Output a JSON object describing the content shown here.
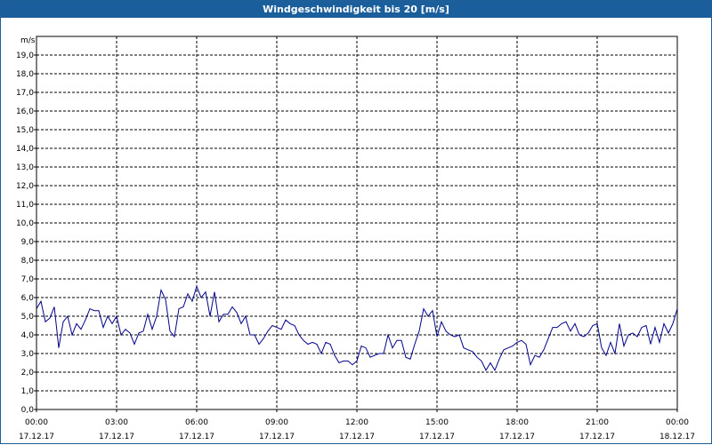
{
  "window": {
    "title": "Windgeschwindigkeit bis 20 [m/s]"
  },
  "colors": {
    "titlebar": "#1a5f9c",
    "line": "#00008b",
    "grid": "#000000",
    "background": "#ffffff"
  },
  "chart_data": {
    "type": "line",
    "title": "Windgeschwindigkeit bis 20 [m/s]",
    "ylabel": "m/s",
    "xlabel": "",
    "ylim": [
      0,
      20
    ],
    "xlim": [
      0,
      24
    ],
    "grid": true,
    "y_ticks": [
      "0,0",
      "1,0",
      "2,0",
      "3,0",
      "4,0",
      "5,0",
      "6,0",
      "7,0",
      "8,0",
      "9,0",
      "10,0",
      "11,0",
      "12,0",
      "13,0",
      "14,0",
      "15,0",
      "16,0",
      "17,0",
      "18,0",
      "19,0"
    ],
    "x_ticks": [
      {
        "time": "00:00",
        "date": "17.12.17"
      },
      {
        "time": "03:00",
        "date": "17.12.17"
      },
      {
        "time": "06:00",
        "date": "17.12.17"
      },
      {
        "time": "09:00",
        "date": "17.12.17"
      },
      {
        "time": "12:00",
        "date": "17.12.17"
      },
      {
        "time": "15:00",
        "date": "17.12.17"
      },
      {
        "time": "18:00",
        "date": "17.12.17"
      },
      {
        "time": "21:00",
        "date": "17.12.17"
      },
      {
        "time": "00:00",
        "date": "18.12.17"
      }
    ],
    "series": [
      {
        "x": [
          0,
          0.167,
          0.333,
          0.5,
          0.667,
          0.833,
          1,
          1.167,
          1.333,
          1.5,
          1.667,
          1.833,
          2,
          2.167,
          2.333,
          2.5,
          2.667,
          2.833,
          3,
          3.167,
          3.333,
          3.5,
          3.667,
          3.833,
          4,
          4.167,
          4.333,
          4.5,
          4.667,
          4.833,
          5,
          5.167,
          5.333,
          5.5,
          5.667,
          5.833,
          6,
          6.167,
          6.333,
          6.5,
          6.667,
          6.833,
          7,
          7.167,
          7.333,
          7.5,
          7.667,
          7.833,
          8,
          8.167,
          8.333,
          8.5,
          8.667,
          8.833,
          9,
          9.167,
          9.333,
          9.5,
          9.667,
          9.833,
          10,
          10.167,
          10.333,
          10.5,
          10.667,
          10.833,
          11,
          11.167,
          11.333,
          11.5,
          11.667,
          11.833,
          12,
          12.167,
          12.333,
          12.5,
          12.667,
          12.833,
          13,
          13.167,
          13.333,
          13.5,
          13.667,
          13.833,
          14,
          14.167,
          14.333,
          14.5,
          14.667,
          14.833,
          15,
          15.167,
          15.333,
          15.5,
          15.667,
          15.833,
          16,
          16.167,
          16.333,
          16.5,
          16.667,
          16.833,
          17,
          17.167,
          17.333,
          17.5,
          17.667,
          17.833,
          18,
          18.167,
          18.333,
          18.5,
          18.667,
          18.833,
          19,
          19.167,
          19.333,
          19.5,
          19.667,
          19.833,
          20,
          20.167,
          20.333,
          20.5,
          20.667,
          20.833,
          21,
          21.167,
          21.333,
          21.5,
          21.667,
          21.833,
          22,
          22.167,
          22.333,
          22.5,
          22.667,
          22.833,
          23,
          23.167,
          23.333,
          23.5,
          23.667,
          23.833,
          24
        ],
        "values": [
          5.4,
          5.8,
          4.7,
          4.9,
          5.5,
          3.3,
          4.7,
          5.0,
          4.0,
          4.6,
          4.3,
          4.8,
          5.4,
          5.3,
          5.3,
          4.4,
          5.0,
          4.6,
          5.0,
          4.0,
          4.3,
          4.1,
          3.5,
          4.1,
          4.2,
          5.1,
          4.3,
          5.0,
          6.4,
          5.9,
          4.2,
          3.9,
          5.4,
          5.5,
          6.2,
          5.8,
          6.6,
          6.0,
          6.3,
          5.0,
          6.3,
          4.7,
          5.1,
          5.1,
          5.5,
          5.2,
          4.6,
          5.0,
          4.0,
          4.0,
          3.5,
          3.8,
          4.2,
          4.5,
          4.4,
          4.3,
          4.8,
          4.6,
          4.5,
          4.0,
          3.7,
          3.5,
          3.6,
          3.5,
          3.0,
          3.6,
          3.5,
          2.9,
          2.5,
          2.6,
          2.6,
          2.4,
          2.6,
          3.4,
          3.3,
          2.8,
          2.9,
          3.0,
          3.0,
          4.0,
          3.3,
          3.7,
          3.7,
          2.8,
          2.7,
          3.5,
          4.2,
          5.4,
          5.0,
          5.3,
          3.9,
          4.7,
          4.2,
          4.0,
          3.9,
          4.0,
          3.3,
          3.2,
          3.1,
          2.8,
          2.6,
          2.1,
          2.5,
          2.1,
          2.7,
          3.2,
          3.3,
          3.4,
          3.6,
          3.7,
          3.5,
          2.4,
          2.9,
          2.8,
          3.2,
          3.8,
          4.4,
          4.4,
          4.6,
          4.7,
          4.2,
          4.6,
          4.0,
          3.9,
          4.1,
          4.5,
          4.6,
          3.3,
          2.9,
          3.6,
          3.0,
          4.6,
          3.4,
          4.0,
          4.1,
          3.9,
          4.4,
          4.5,
          3.5,
          4.4,
          3.6,
          4.6,
          4.1,
          4.6,
          5.4
        ]
      }
    ]
  }
}
